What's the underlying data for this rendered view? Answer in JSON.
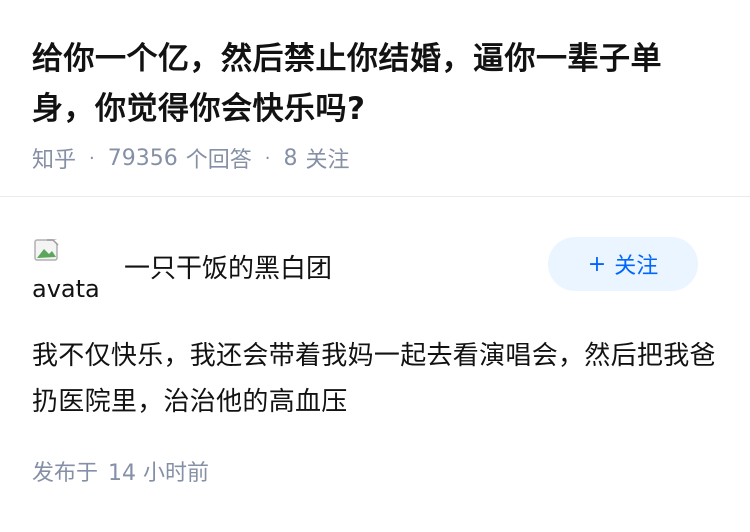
{
  "question": {
    "title": "给你一个亿，然后禁止你结婚，逼你一辈子单身，你觉得你会快乐吗?",
    "source": "知乎",
    "answers_count": "79356",
    "answers_label": "个回答",
    "followers_count": "8",
    "followers_label": "关注"
  },
  "answer": {
    "author": {
      "avatar_alt": "avatar",
      "name": "一只干饭的黑白团"
    },
    "follow_button": {
      "icon": "plus-icon",
      "plus": "+",
      "label": "关注"
    },
    "content": "我不仅快乐，我还会带着我妈一起去看演唱会，然后把我爸扔医院里，治治他的高血压",
    "published_label": "发布于",
    "published_time": "14 小时前"
  },
  "colors": {
    "meta_gray": "#8590a6",
    "accent_blue": "#0066ff",
    "button_bg": "#ebf5ff",
    "text": "#121212"
  }
}
